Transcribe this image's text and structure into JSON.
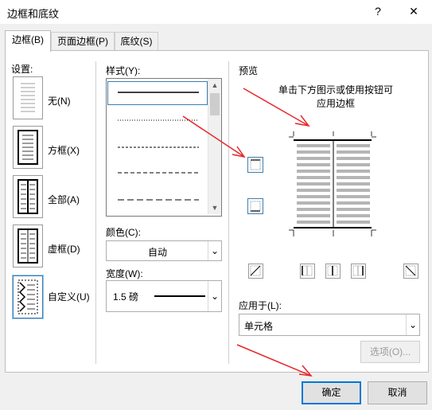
{
  "window": {
    "title": "边框和底纹",
    "help_label": "?",
    "close_label": "✕"
  },
  "tabs": [
    {
      "label": "边框(B)"
    },
    {
      "label": "页面边框(P)"
    },
    {
      "label": "底纹(S)"
    }
  ],
  "settings": {
    "label": "设置:",
    "items": [
      {
        "label": "无(N)"
      },
      {
        "label": "方框(X)"
      },
      {
        "label": "全部(A)"
      },
      {
        "label": "虚框(D)"
      },
      {
        "label": "自定义(U)"
      }
    ]
  },
  "style": {
    "label": "样式(Y):",
    "line_styles": [
      "solid",
      "dotted",
      "dash-small",
      "dash-medium",
      "dash-long"
    ]
  },
  "color": {
    "label": "颜色(C):",
    "value": "自动"
  },
  "width": {
    "label": "宽度(W):",
    "value": "1.5 磅"
  },
  "preview": {
    "label": "预览",
    "hint_line1": "单击下方图示或使用按钮可",
    "hint_line2": "应用边框"
  },
  "apply_to": {
    "label": "应用于(L):",
    "value": "单元格"
  },
  "buttons": {
    "options": "选项(O)...",
    "ok": "确定",
    "cancel": "取消"
  },
  "colors": {
    "arrow": "#e8262b",
    "selection": "#3c7fb1"
  }
}
